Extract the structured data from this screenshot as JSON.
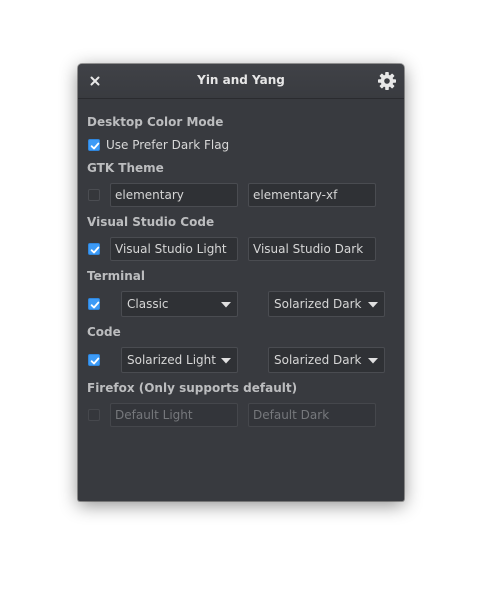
{
  "window": {
    "title": "Yin and Yang"
  },
  "icons": {
    "close": "close-icon",
    "settings": "gear-icon",
    "checkmark": "check-icon",
    "dropdown": "triangle-down-icon"
  },
  "colors": {
    "window_bg": "#383a3f",
    "accent": "#3d9bf7",
    "text": "#d8d8d8",
    "heading": "#bcbdbf"
  },
  "desktop": {
    "title": "Desktop Color Mode",
    "prefer_dark_label": "Use Prefer Dark Flag",
    "prefer_dark_checked": true
  },
  "gtk": {
    "title": "GTK Theme",
    "enabled": false,
    "light_value": "elementary",
    "dark_value": "elementary-xf"
  },
  "vscode": {
    "title": "Visual Studio Code",
    "enabled": true,
    "light_value": "Visual Studio Light",
    "dark_value": "Visual Studio Dark"
  },
  "terminal": {
    "title": "Terminal",
    "enabled": true,
    "light_value": "Classic",
    "dark_value": "Solarized Dark"
  },
  "code": {
    "title": "Code",
    "enabled": true,
    "light_value": "Solarized Light",
    "dark_value": "Solarized Dark"
  },
  "firefox": {
    "title": "Firefox (Only supports default)",
    "enabled": false,
    "light_placeholder": "Default Light",
    "dark_placeholder": "Default Dark"
  }
}
